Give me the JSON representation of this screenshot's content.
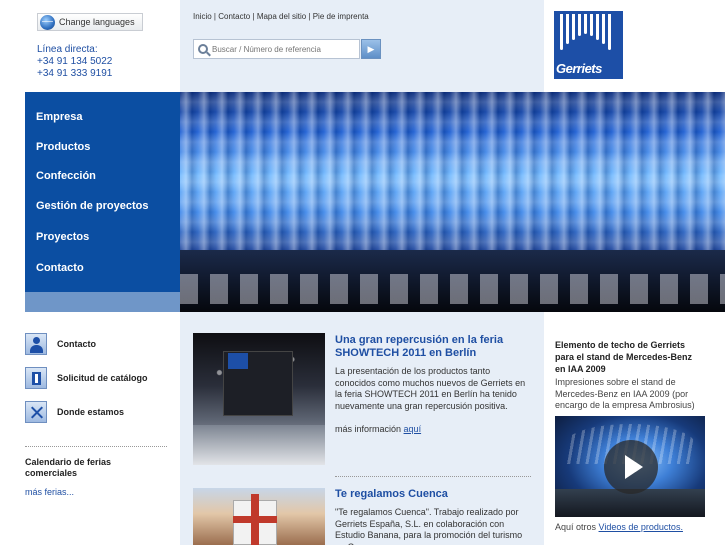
{
  "header": {
    "language_button": "Change languages",
    "hotline_label": "Línea directa:",
    "phone_1": "+34 91 134 5022",
    "phone_2": "+34 91 333 9191",
    "topnav": {
      "inicio": "Inicio",
      "contacto": "Contacto",
      "mapa": "Mapa del sitio",
      "pie": "Pie de imprenta",
      "separator": "|"
    },
    "search_placeholder": "Buscar / Número de referencia",
    "search_button_icon": "arrow-right-icon",
    "logo_text": "Gerriets"
  },
  "sidebar": {
    "items": [
      {
        "label": "Empresa"
      },
      {
        "label": "Productos"
      },
      {
        "label": "Confección"
      },
      {
        "label": "Gestión de proyectos"
      },
      {
        "label": "Proyectos"
      },
      {
        "label": "Contacto"
      }
    ]
  },
  "quick_links": [
    {
      "label": "Contacto",
      "icon": "person-icon"
    },
    {
      "label": "Solicitud de catálogo",
      "icon": "catalog-icon"
    },
    {
      "label": "Donde estamos",
      "icon": "location-icon"
    }
  ],
  "fairs": {
    "title": "Calendario de ferias comerciales",
    "link": "más ferias..."
  },
  "news": [
    {
      "title": "Una gran repercusión en la feria SHOWTECH 2011 en Berlín",
      "text": "La presentación de los productos tanto conocidos como muchos nuevos de Gerriets en la feria SHOWTECH 2011 en Berlín ha tenido nuevamente una gran repercusión positiva.",
      "more_label": "más información",
      "more_link": "aquí"
    },
    {
      "title": "Te regalamos Cuenca",
      "text": "\"Te regalamos Cuenca\". Trabajo realizado por Gerriets España, S.L. en colaboración con Estudio Banana, para la promoción del turismo en Cuenca."
    }
  ],
  "feature": {
    "title": "Elemento de techo de Gerriets para el stand de Mercedes-Benz en IAA 2009",
    "text": "Impresiones sobre el stand de Mercedes-Benz en IAA 2009 (por encargo de la empresa Ambrosius)",
    "more_label": "Aquí otros",
    "more_link": "Videos de productos.",
    "play_icon": "play-icon"
  },
  "colors": {
    "brand_blue": "#0b4ea2",
    "link_blue": "#1f4fa3",
    "panel_bg": "#e7eef7"
  }
}
